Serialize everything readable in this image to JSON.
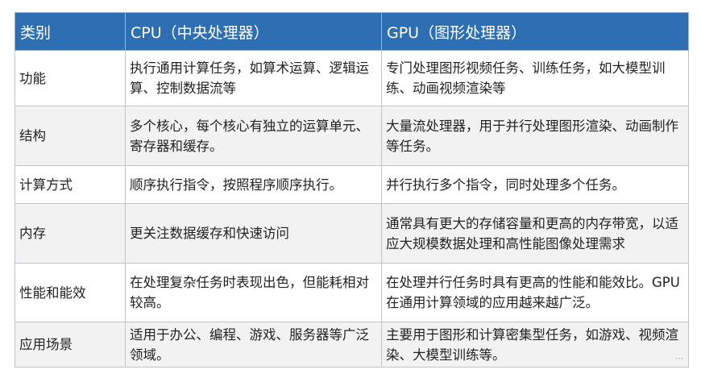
{
  "table": {
    "headers": [
      "类别",
      "CPU（中央处理器）",
      "GPU（图形处理器）"
    ],
    "rows": [
      {
        "category": "功能",
        "cpu": "执行通用计算任务，如算术运算、逻辑运算、控制数据流等",
        "gpu": "专门处理图形视频任务、训练任务，如大模型训练、动画视频渲染等"
      },
      {
        "category": "结构",
        "cpu": "多个核心，每个核心有独立的运算单元、寄存器和缓存。",
        "gpu": "大量流处理器，用于并行处理图形渲染、动画制作等任务。"
      },
      {
        "category": "计算方式",
        "cpu": "顺序执行指令，按照程序顺序执行。",
        "gpu": "并行执行多个指令，同时处理多个任务。"
      },
      {
        "category": "内存",
        "cpu": "更关注数据缓存和快速访问",
        "gpu": "通常具有更大的存储容量和更高的内存带宽，以适应大规模数据处理和高性能图像处理需求"
      },
      {
        "category": "性能和能效",
        "cpu": "在处理复杂任务时表现出色，但能耗相对较高。",
        "gpu": "在处理并行任务时具有更高的性能和能效比。GPU在通用计算领域的应用越来越广泛。"
      },
      {
        "category": "应用场景",
        "cpu": "适用于办公、编程、游戏、服务器等广泛领域。",
        "gpu": "主要用于图形和计算密集型任务，如游戏、视频渲染、大模型训练等。"
      }
    ]
  },
  "corner_mark": "⋯"
}
